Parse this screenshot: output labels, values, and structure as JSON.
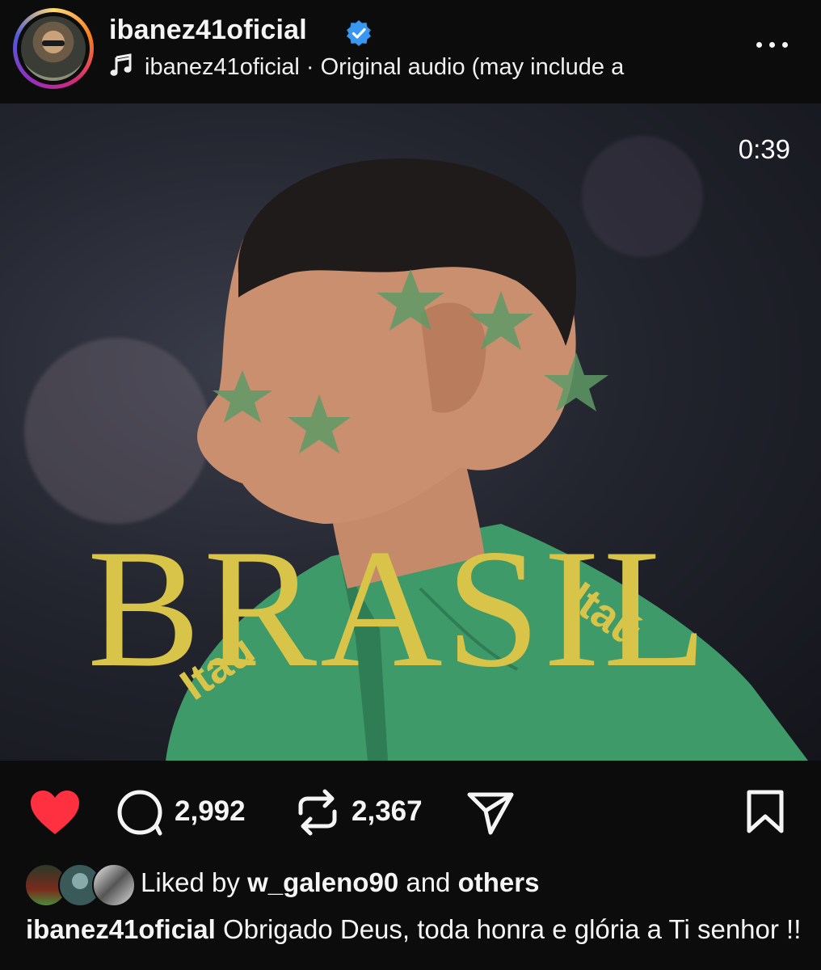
{
  "post": {
    "username": "ibanez41oficial",
    "audio_text": "ibanez41oficial · Original audio  (may include a",
    "duration": "0:39",
    "overlay_text": "BRASIL",
    "comments_count": "2,992",
    "reposts_count": "2,367",
    "liked_by_prefix": "Liked by",
    "liked_by_user": "w_galeno90",
    "liked_by_and": "and",
    "liked_by_others": "others",
    "caption_user": "ibanez41oficial",
    "caption_text": "Obrigado Deus, toda honra e glória a Ti senhor !!"
  },
  "icons": {
    "verified": "verified-badge-icon",
    "audio": "music-note-icon",
    "more": "more-options-icon",
    "mute": "muted-speaker-icon",
    "like": "heart-icon",
    "comment": "comment-icon",
    "repost": "repost-icon",
    "share": "send-icon",
    "save": "bookmark-icon"
  },
  "colors": {
    "background": "#0c0c0c",
    "like_active": "#ff3040",
    "verified": "#3897f0",
    "overlay_text": "#d9c44a"
  }
}
